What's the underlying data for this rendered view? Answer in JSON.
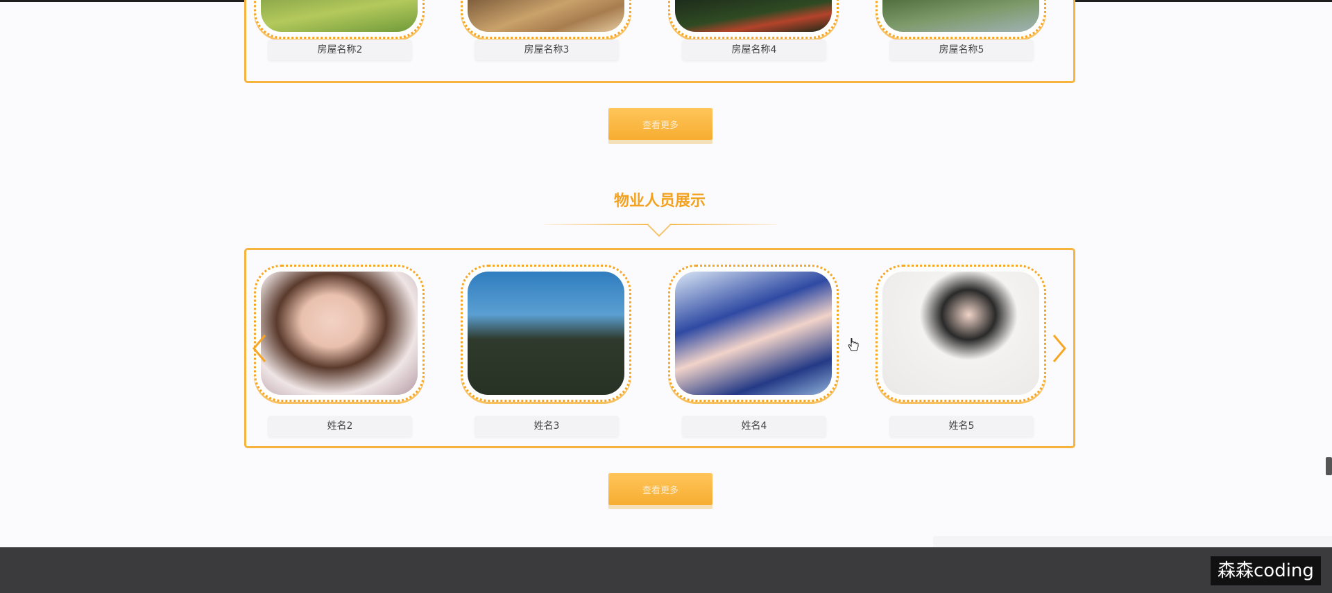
{
  "houses_section": {
    "items": [
      {
        "name": "房屋名称2",
        "image": "green-lawn-photo"
      },
      {
        "name": "房屋名称3",
        "image": "interior-furniture-photo"
      },
      {
        "name": "房屋名称4",
        "image": "night-garden-photo"
      },
      {
        "name": "房屋名称5",
        "image": "landscape-view-photo"
      }
    ],
    "more_button": "查看更多"
  },
  "staff_section": {
    "title": "物业人员展示",
    "items": [
      {
        "name": "姓名2",
        "image": "young-man-portrait"
      },
      {
        "name": "姓名3",
        "image": "man-outdoor-portrait"
      },
      {
        "name": "姓名4",
        "image": "woman-cap-portrait"
      },
      {
        "name": "姓名5",
        "image": "woman-white-dress-portrait"
      }
    ],
    "prev_icon": "chevron-left-icon",
    "next_icon": "chevron-right-icon",
    "more_button": "查看更多"
  },
  "watermark": "森森coding",
  "colors": {
    "accent": "#f6b33d",
    "title": "#f3a21f",
    "footer": "#3b3b3d",
    "background": "#fbfbfd"
  }
}
